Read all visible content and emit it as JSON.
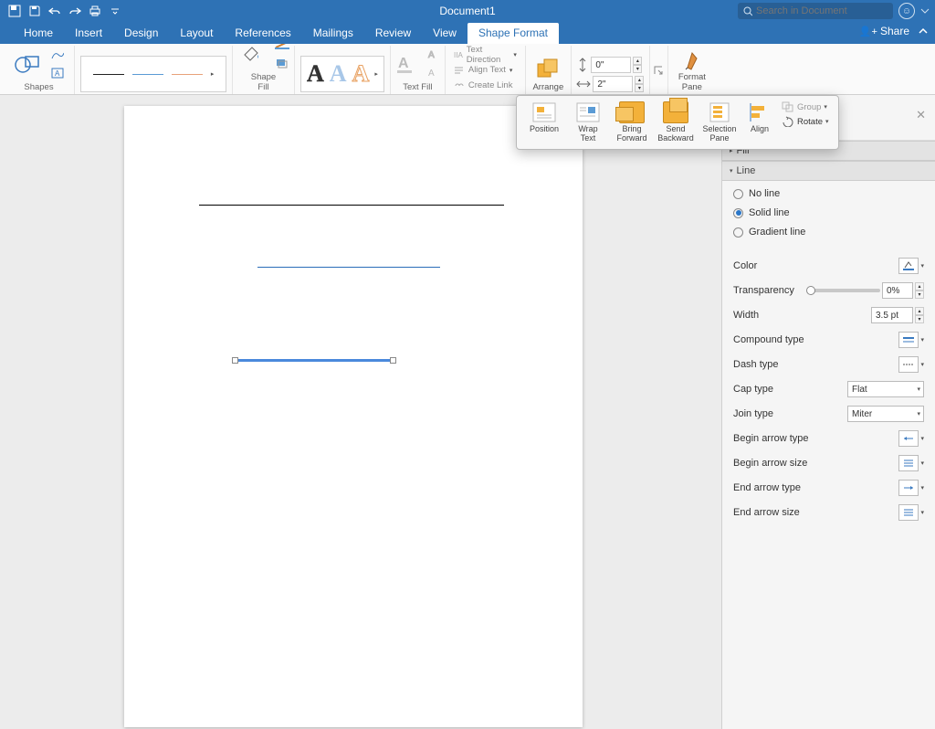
{
  "app": {
    "title": "Document1",
    "search_placeholder": "Search in Document",
    "share_label": "Share"
  },
  "tabs": [
    "Home",
    "Insert",
    "Design",
    "Layout",
    "References",
    "Mailings",
    "Review",
    "View",
    "Shape Format"
  ],
  "active_tab": "Shape Format",
  "ribbon": {
    "shapes_label": "Shapes",
    "shape_fill_label": "Shape\nFill",
    "text_fill_label": "Text Fill",
    "text_direction": "Text Direction",
    "align_text": "Align Text",
    "create_link": "Create Link",
    "arrange_label": "Arrange",
    "height_val": "0\"",
    "width_val": "2\"",
    "format_pane_label": "Format\nPane"
  },
  "arrange": {
    "items": [
      "Position",
      "Wrap\nText",
      "Bring\nForward",
      "Send\nBackward",
      "Selection\nPane",
      "Align"
    ],
    "group": "Group",
    "rotate": "Rotate"
  },
  "pane": {
    "fill_hdr": "Fill",
    "line_hdr": "Line",
    "no_line": "No line",
    "solid_line": "Solid line",
    "gradient_line": "Gradient line",
    "color": "Color",
    "transparency": "Transparency",
    "transparency_val": "0%",
    "width": "Width",
    "width_val": "3.5 pt",
    "compound": "Compound type",
    "dash": "Dash type",
    "cap": "Cap type",
    "cap_val": "Flat",
    "join": "Join type",
    "join_val": "Miter",
    "begin_type": "Begin arrow type",
    "begin_size": "Begin arrow size",
    "end_type": "End arrow type",
    "end_size": "End arrow size"
  }
}
